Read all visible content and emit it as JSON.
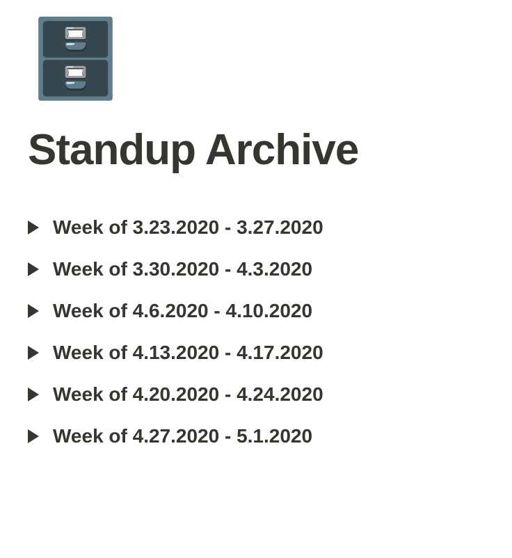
{
  "icon": "🗄️",
  "title": "Standup Archive",
  "weeks": [
    {
      "label": "Week of 3.23.2020 - 3.27.2020"
    },
    {
      "label": "Week of 3.30.2020 - 4.3.2020"
    },
    {
      "label": "Week of 4.6.2020 - 4.10.2020"
    },
    {
      "label": "Week of 4.13.2020 - 4.17.2020"
    },
    {
      "label": "Week of 4.20.2020 - 4.24.2020"
    },
    {
      "label": "Week of 4.27.2020 - 5.1.2020"
    }
  ]
}
